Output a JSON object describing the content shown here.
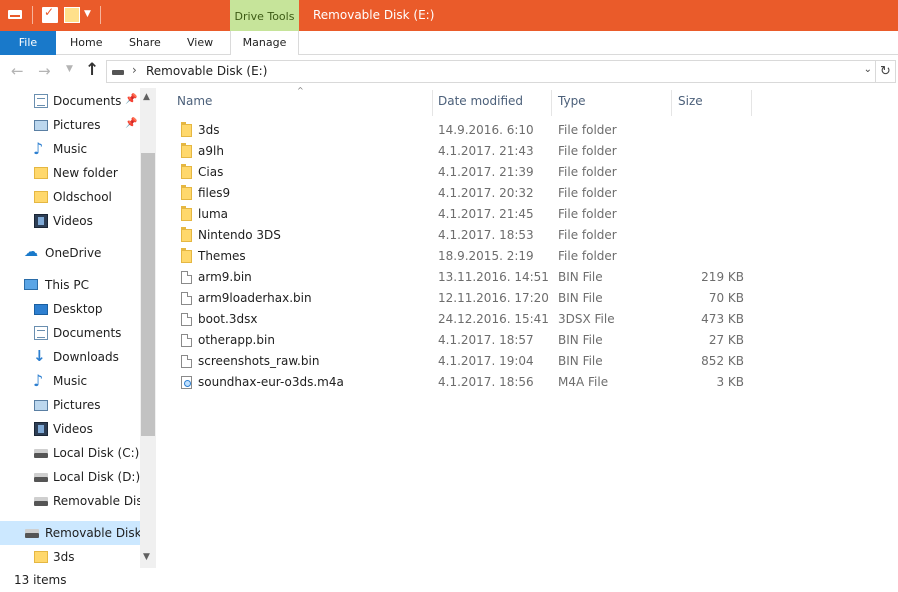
{
  "titlebar": {
    "window_title": "Removable Disk (E:)",
    "contextual_tab": "Drive Tools",
    "accent_color": "#ea5b2a"
  },
  "ribbon": {
    "tabs": {
      "file": "File",
      "home": "Home",
      "share": "Share",
      "view": "View",
      "manage": "Manage"
    }
  },
  "address": {
    "path": "Removable Disk (E:)"
  },
  "navigation": {
    "items": [
      {
        "label": "Documents",
        "icon": "documents-icon",
        "pinned": true
      },
      {
        "label": "Pictures",
        "icon": "pictures-icon",
        "pinned": true
      },
      {
        "label": "Music",
        "icon": "music-icon",
        "pinned": false
      },
      {
        "label": "New folder",
        "icon": "folder-icon",
        "pinned": false
      },
      {
        "label": "Oldschool",
        "icon": "folder-icon",
        "pinned": false
      },
      {
        "label": "Videos",
        "icon": "videos-icon",
        "pinned": false
      },
      {
        "label": "OneDrive",
        "icon": "onedrive-icon",
        "pinned": false
      },
      {
        "label": "This PC",
        "icon": "this-pc-icon",
        "pinned": false
      },
      {
        "label": "Desktop",
        "icon": "desktop-icon",
        "pinned": false
      },
      {
        "label": "Documents",
        "icon": "documents-icon",
        "pinned": false
      },
      {
        "label": "Downloads",
        "icon": "downloads-icon",
        "pinned": false
      },
      {
        "label": "Music",
        "icon": "music-icon",
        "pinned": false
      },
      {
        "label": "Pictures",
        "icon": "pictures-icon",
        "pinned": false
      },
      {
        "label": "Videos",
        "icon": "videos-icon",
        "pinned": false
      },
      {
        "label": "Local Disk (C:)",
        "icon": "drive-icon",
        "pinned": false
      },
      {
        "label": "Local Disk (D:)",
        "icon": "drive-icon",
        "pinned": false
      },
      {
        "label": "Removable Disk",
        "icon": "drive-icon",
        "pinned": false
      },
      {
        "label": "Removable Disk (E",
        "icon": "drive-icon",
        "pinned": false,
        "selected": true
      },
      {
        "label": "3ds",
        "icon": "folder-icon",
        "pinned": false
      }
    ]
  },
  "files": {
    "columns": {
      "name": "Name",
      "date": "Date modified",
      "type": "Type",
      "size": "Size"
    },
    "rows": [
      {
        "name": "3ds",
        "date": "14.9.2016. 6:10",
        "type": "File folder",
        "size": "",
        "icon": "folder-icon"
      },
      {
        "name": "a9lh",
        "date": "4.1.2017. 21:43",
        "type": "File folder",
        "size": "",
        "icon": "folder-icon"
      },
      {
        "name": "Cias",
        "date": "4.1.2017. 21:39",
        "type": "File folder",
        "size": "",
        "icon": "folder-icon"
      },
      {
        "name": "files9",
        "date": "4.1.2017. 20:32",
        "type": "File folder",
        "size": "",
        "icon": "folder-icon"
      },
      {
        "name": "luma",
        "date": "4.1.2017. 21:45",
        "type": "File folder",
        "size": "",
        "icon": "folder-icon"
      },
      {
        "name": "Nintendo 3DS",
        "date": "4.1.2017. 18:53",
        "type": "File folder",
        "size": "",
        "icon": "folder-icon"
      },
      {
        "name": "Themes",
        "date": "18.9.2015. 2:19",
        "type": "File folder",
        "size": "",
        "icon": "folder-icon"
      },
      {
        "name": "arm9.bin",
        "date": "13.11.2016. 14:51",
        "type": "BIN File",
        "size": "219 KB",
        "icon": "file-icon"
      },
      {
        "name": "arm9loaderhax.bin",
        "date": "12.11.2016. 17:20",
        "type": "BIN File",
        "size": "70 KB",
        "icon": "file-icon"
      },
      {
        "name": "boot.3dsx",
        "date": "24.12.2016. 15:41",
        "type": "3DSX File",
        "size": "473 KB",
        "icon": "file-icon"
      },
      {
        "name": "otherapp.bin",
        "date": "4.1.2017. 18:57",
        "type": "BIN File",
        "size": "27 KB",
        "icon": "file-icon"
      },
      {
        "name": "screenshots_raw.bin",
        "date": "4.1.2017. 19:04",
        "type": "BIN File",
        "size": "852 KB",
        "icon": "file-icon"
      },
      {
        "name": "soundhax-eur-o3ds.m4a",
        "date": "4.1.2017. 18:56",
        "type": "M4A File",
        "size": "3 KB",
        "icon": "media-file-icon"
      }
    ]
  },
  "status": {
    "item_count": "13 items"
  }
}
